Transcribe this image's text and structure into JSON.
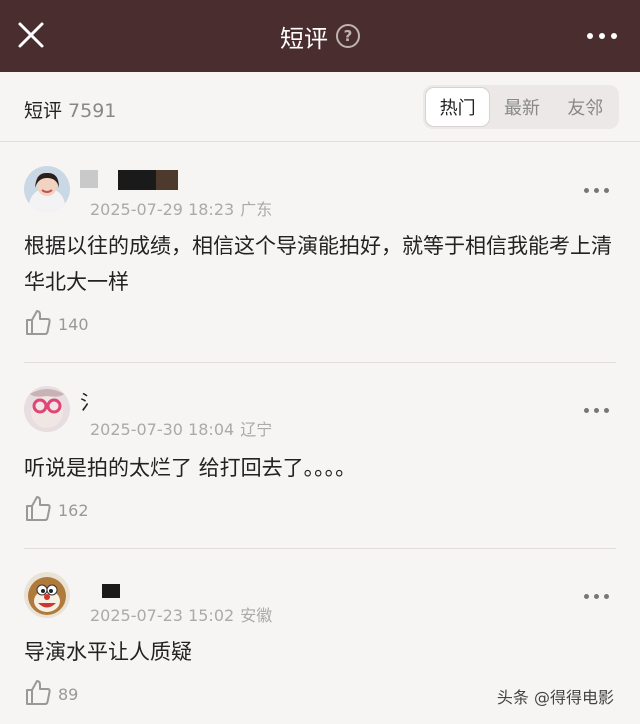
{
  "header": {
    "title": "短评",
    "help_glyph": "?",
    "bg_color": "#4a2d2e"
  },
  "summary": {
    "label": "短评",
    "count": "7591"
  },
  "sort_tabs": [
    {
      "label": "热门",
      "active": true
    },
    {
      "label": "最新",
      "active": false
    },
    {
      "label": "友邻",
      "active": false
    }
  ],
  "comments": [
    {
      "name_visible": "",
      "date": "2025-07-29 18:23",
      "location": "广东",
      "text": "根据以往的成绩，相信这个导演能拍好，就等于相信我能考上清华北大一样",
      "likes": "140",
      "avatar": "photo-girl-avatar"
    },
    {
      "name_visible": "氵",
      "date": "2025-07-30 18:04",
      "location": "辽宁",
      "text": "听说是拍的太烂了 给打回去了。。。。",
      "likes": "162",
      "avatar": "pink-glasses-avatar"
    },
    {
      "name_visible": "",
      "date": "2025-07-23 15:02",
      "location": "安徽",
      "text": "导演水平让人质疑",
      "likes": "89",
      "avatar": "doraemon-avatar"
    }
  ],
  "watermark": "头条 @得得电影"
}
